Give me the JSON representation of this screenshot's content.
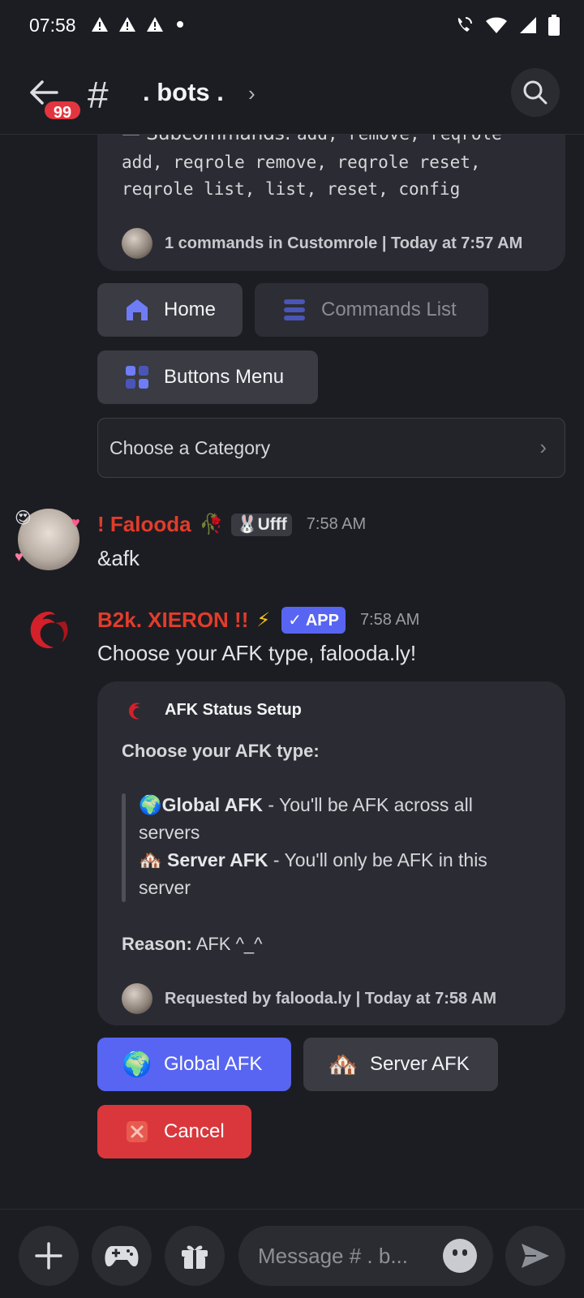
{
  "status_bar": {
    "time": "07:58"
  },
  "header": {
    "badge": "99",
    "hash": "#",
    "channel": ". bots .",
    "chevron": "›"
  },
  "embed_top": {
    "line0_prefix": "— Subcommands:",
    "line0_cmds": "add, remove, reqrole",
    "line1": "add, reqrole remove, reqrole reset,",
    "line2": "reqrole list, list, reset, config",
    "footer": "1 commands in Customrole | Today at 7:57 AM"
  },
  "buttons_top": {
    "home": "Home",
    "commands_list": "Commands List",
    "buttons_menu": "Buttons Menu"
  },
  "select": {
    "placeholder": "Choose a Category"
  },
  "message1": {
    "username": "! Falooda",
    "tag": "Ufff",
    "time": "7:58 AM",
    "content": "&afk"
  },
  "message2": {
    "username": "B2k. XIERON !!",
    "app_badge": "APP",
    "time": "7:58 AM",
    "content": "Choose your AFK type, falooda.ly!"
  },
  "embed_afk": {
    "author": "AFK Status Setup",
    "title": "Choose your AFK type:",
    "global_label": "Global AFK",
    "global_desc": " - You'll be AFK across all",
    "global_desc2": "servers",
    "server_label": "Server AFK",
    "server_desc": " - You'll only be AFK in this",
    "server_desc2": "server",
    "reason_label": "Reason:",
    "reason_value": " AFK ^_^",
    "footer": "Requested by falooda.ly | Today at 7:58 AM"
  },
  "buttons_afk": {
    "global": "Global AFK",
    "server": "Server AFK",
    "cancel": "Cancel"
  },
  "composer": {
    "placeholder": "Message # . b..."
  },
  "colors": {
    "background": "#1c1d22",
    "blurple": "#5865f2",
    "danger": "#da373c",
    "username_red": "#e23c2b"
  }
}
